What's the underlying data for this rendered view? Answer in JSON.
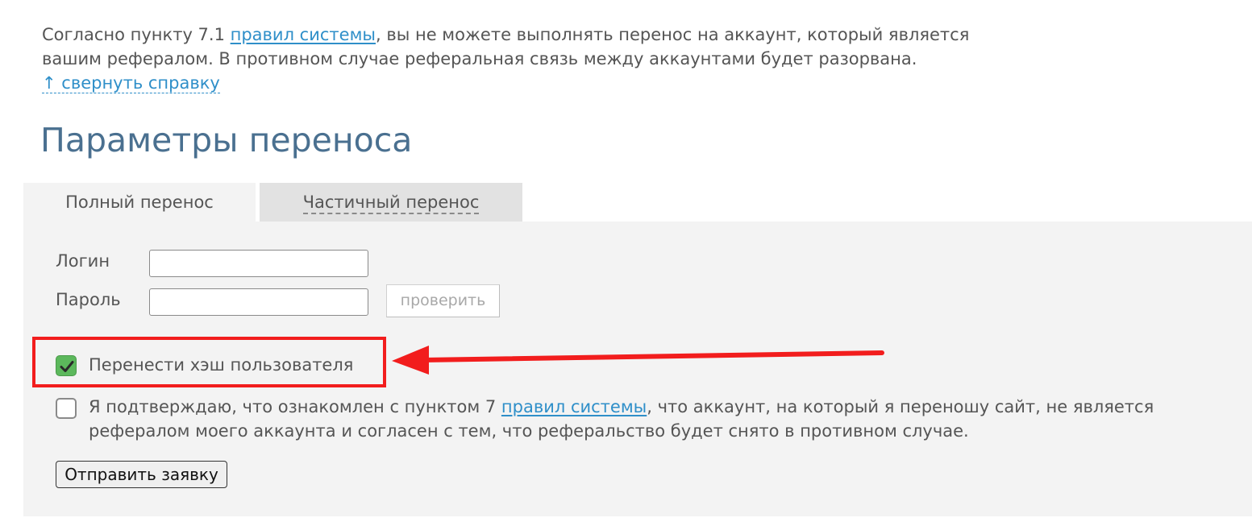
{
  "help": {
    "text_before_link": "Согласно пункту 7.1 ",
    "rules_link": "правил системы",
    "text_after_link_line1": ", вы не можете выполнять перенос на аккаунт, который является",
    "text_line2": "вашим рефералом. В противном случае реферальная связь между аккаунтами будет разорвана.",
    "collapse_link": "↑ свернуть справку"
  },
  "page_title": "Параметры переноса",
  "tabs": [
    {
      "label": "Полный перенос",
      "active": true
    },
    {
      "label": "Частичный перенос",
      "active": false
    }
  ],
  "form": {
    "login_label": "Логин",
    "login_value": "",
    "password_label": "Пароль",
    "password_value": "",
    "check_button": "проверить",
    "transfer_hash_label": "Перенести хэш пользователя",
    "transfer_hash_checked": true,
    "confirm_text_before_link": "Я подтверждаю, что ознакомлен с пунктом 7 ",
    "confirm_rules_link": "правил системы",
    "confirm_text_after_link": ", что аккаунт, на который я переношу сайт, не является",
    "confirm_text_line2": "рефералом моего аккаунта и согласен с тем, что реферальство будет снято в противном случае.",
    "confirm_checked": false,
    "submit_button": "Отправить заявку"
  },
  "colors": {
    "link": "#2f8fc9",
    "title": "#4a7090",
    "panel_bg": "#f3f3f3",
    "inactive_tab_bg": "#e2e2e2",
    "checkbox_checked": "#5cb85c",
    "annotation_red": "#f21d1d"
  },
  "icons": {
    "checkmark": "check-icon",
    "annotation": "arrow-left-icon"
  }
}
